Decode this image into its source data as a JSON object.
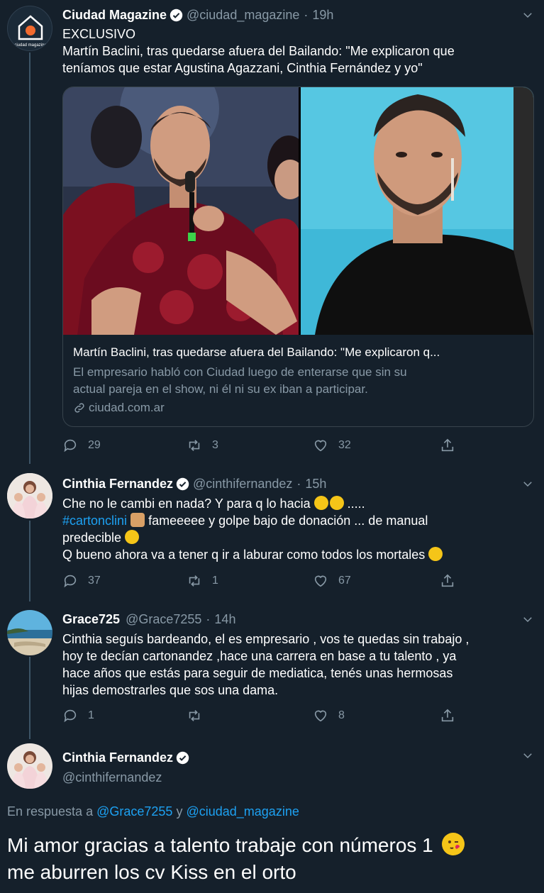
{
  "tweet1": {
    "name": "Ciudad Magazine",
    "handle": "@ciudad_magazine",
    "time": "19h",
    "lines": [
      "EXCLUSIVO",
      "Martín Baclini, tras quedarse afuera del Bailando: \"Me explicaron que",
      "teníamos que estar Agustina Agazzani, Cinthia Fernández y yo\""
    ],
    "avatar_label": "ciudad magazine",
    "card": {
      "title": "Martín Baclini, tras quedarse afuera del Bailando: \"Me explicaron q...",
      "desc1": "El empresario habló con Ciudad luego de enterarse que sin su",
      "desc2": "actual pareja en el show, ni él ni su ex iban a participar.",
      "domain": "ciudad.com.ar"
    },
    "replies": "29",
    "retweets": "3",
    "likes": "32"
  },
  "tweet2": {
    "name": "Cinthia Fernandez",
    "handle": "@cinthifernandez",
    "time": "15h",
    "line1": "Che no le cambi en nada? Y para q lo hacia",
    "line1_end": ".....",
    "hashtag": "#cartonclini",
    "line2_rest": "fameeeee y golpe bajo de donación ... de manual",
    "line3": "predecible",
    "line4": "Q bueno ahora va a tener q ir a laburar como todos los mortales",
    "replies": "37",
    "retweets": "1",
    "likes": "67"
  },
  "tweet3": {
    "name": "Grace725",
    "handle": "@Grace7255",
    "time": "14h",
    "lines": [
      "Cinthia seguís bardeando, el es empresario , vos te quedas sin trabajo ,",
      "hoy te decían cartonandez ,hace una carrera en base a tu talento , ya",
      "hace años que estás para seguir de mediatica, tenés unas hermosas",
      "hijas demostrarles que sos una dama."
    ],
    "replies": "1",
    "retweets": "",
    "likes": "8"
  },
  "tweet4": {
    "name": "Cinthia Fernandez",
    "handle": "@cinthifernandez",
    "reply_prefix": "En respuesta a",
    "reply_user1": "@Grace7255",
    "reply_and": "y",
    "reply_user2": "@ciudad_magazine",
    "line1": "Mi amor gracias a talento trabaje con números 1",
    "line2": "me aburren los cv Kiss en el orto"
  },
  "colors": {
    "background": "#15202b",
    "text": "#ffffff",
    "secondary": "#8899a6",
    "link": "#1da1f2",
    "border": "#38444d"
  }
}
